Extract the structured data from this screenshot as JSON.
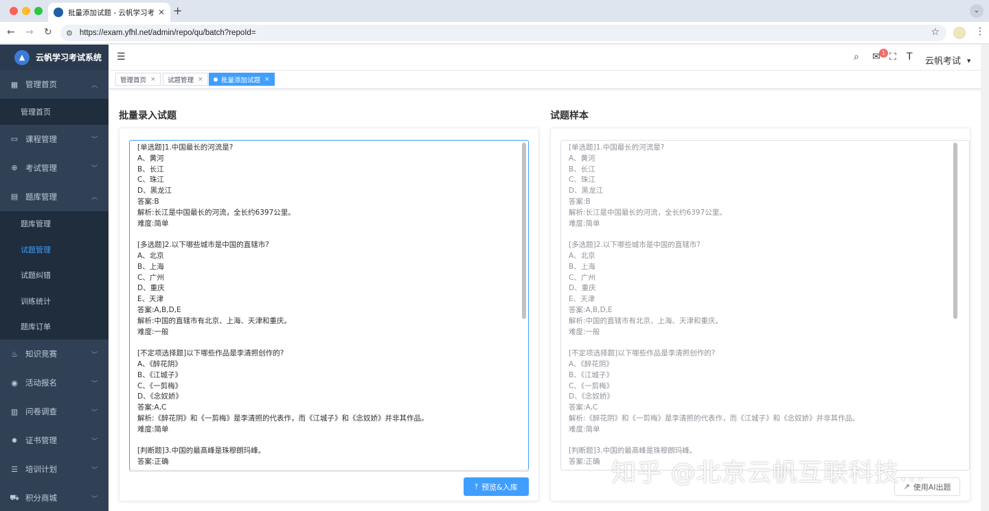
{
  "browser": {
    "tab_title": "批量添加试题 - 云帆学习考试系",
    "url": "https://exam.yfhl.net/admin/repo/qu/batch?repoId="
  },
  "sidebar": {
    "brand": "云帆学习考试系统",
    "menu": [
      {
        "label": "管理首页",
        "icon": "dashboard-icon",
        "expanded": true,
        "children": [
          {
            "label": "管理首页",
            "active": false
          }
        ]
      },
      {
        "label": "课程管理",
        "icon": "monitor-icon",
        "expanded": false
      },
      {
        "label": "考试管理",
        "icon": "target-icon",
        "expanded": false
      },
      {
        "label": "题库管理",
        "icon": "document-icon",
        "expanded": true,
        "children": [
          {
            "label": "题库管理",
            "active": false
          },
          {
            "label": "试题管理",
            "active": true
          },
          {
            "label": "试题纠错",
            "active": false
          },
          {
            "label": "训练统计",
            "active": false
          },
          {
            "label": "题库订单",
            "active": false
          }
        ]
      },
      {
        "label": "知识竞赛",
        "icon": "fire-icon",
        "expanded": false
      },
      {
        "label": "活动报名",
        "icon": "circle-icon",
        "expanded": false
      },
      {
        "label": "问卷调查",
        "icon": "survey-icon",
        "expanded": false
      },
      {
        "label": "证书管理",
        "icon": "gear-icon",
        "expanded": false
      },
      {
        "label": "培训计划",
        "icon": "list-icon",
        "expanded": false
      },
      {
        "label": "积分商城",
        "icon": "cart-icon",
        "expanded": false
      }
    ]
  },
  "navbar": {
    "user": "云帆考试",
    "message_count": "1"
  },
  "tags": [
    {
      "label": "管理首页",
      "active": false
    },
    {
      "label": "试题管理",
      "active": false
    },
    {
      "label": "批量添加试题",
      "active": true
    }
  ],
  "left_panel": {
    "title": "批量录入试题",
    "content": "[单选题]1.中国最长的河流是?\nA、黄河\nB、长江\nC、珠江\nD、黑龙江\n答案:B\n解析:长江是中国最长的河流，全长约6397公里。\n难度:简单\n\n[多选题]2.以下哪些城市是中国的直辖市?\nA、北京\nB、上海\nC、广州\nD、重庆\nE、天津\n答案:A,B,D,E\n解析:中国的直辖市有北京、上海、天津和重庆。\n难度:一般\n\n[不定项选择题]以下哪些作品是李清照创作的?\nA、《醉花阴》\nB、《江城子》\nC、《一剪梅》\nD、《念奴娇》\n答案:A,C\n解析:《醉花阴》和《一剪梅》是李清照的代表作，而《江城子》和《念奴娇》并非其作品。\n难度:简单\n\n[判断题]3.中国的最高峰是珠穆朗玛峰。\n答案:正确",
    "button": "预览&入库"
  },
  "right_panel": {
    "title": "试题样本",
    "content": "[单选题]1.中国最长的河流是?\nA、黄河\nB、长江\nC、珠江\nD、黑龙江\n答案:B\n解析:长江是中国最长的河流，全长约6397公里。\n难度:简单\n\n[多选题]2.以下哪些城市是中国的直辖市?\nA、北京\nB、上海\nC、广州\nD、重庆\nE、天津\n答案:A,B,D,E\n解析:中国的直辖市有北京、上海、天津和重庆。\n难度:一般\n\n[不定项选择题]以下哪些作品是李清照创作的?\nA、《醉花阴》\nB、《江城子》\nC、《一剪梅》\nD、《念奴娇》\n答案:A,C\n解析:《醉花阴》和《一剪梅》是李清照的代表作，而《江城子》和《念奴娇》并非其作品。\n难度:简单\n\n[判断题]3.中国的最高峰是珠穆朗玛峰。\n答案:正确",
    "button": "使用AI出题"
  },
  "watermark": "知乎 @北京云帆互联科技..."
}
